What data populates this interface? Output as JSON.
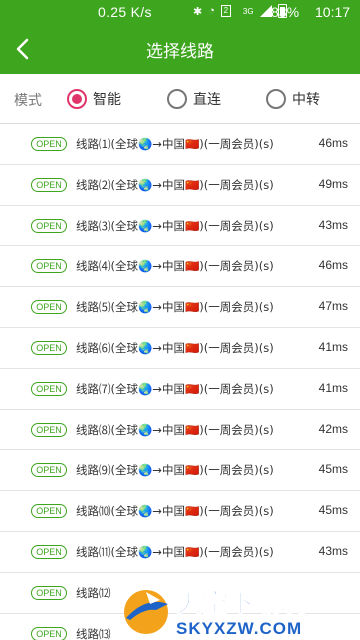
{
  "statusbar": {
    "speed": "0.25 K/s",
    "network_badge": "2",
    "network_type": "3G",
    "battery": "83%",
    "time": "10:17"
  },
  "header": {
    "title": "选择线路",
    "back_icon": "chevron-left-icon"
  },
  "mode": {
    "label": "模式",
    "options": [
      {
        "label": "智能",
        "selected": true
      },
      {
        "label": "直连",
        "selected": false
      },
      {
        "label": "中转",
        "selected": false
      }
    ],
    "accent_color": "#e0356b"
  },
  "theme": {
    "brand_color": "#3ea51f"
  },
  "routes": [
    {
      "badge": "OPEN",
      "name": "线路⑴(全球🌏→中国🇨🇳)(一周会员)(s)",
      "latency": "46ms"
    },
    {
      "badge": "OPEN",
      "name": "线路⑵(全球🌏→中国🇨🇳)(一周会员)(s)",
      "latency": "49ms"
    },
    {
      "badge": "OPEN",
      "name": "线路⑶(全球🌏→中国🇨🇳)(一周会员)(s)",
      "latency": "43ms"
    },
    {
      "badge": "OPEN",
      "name": "线路⑷(全球🌏→中国🇨🇳)(一周会员)(s)",
      "latency": "46ms"
    },
    {
      "badge": "OPEN",
      "name": "线路⑸(全球🌏→中国🇨🇳)(一周会员)(s)",
      "latency": "47ms"
    },
    {
      "badge": "OPEN",
      "name": "线路⑹(全球🌏→中国🇨🇳)(一周会员)(s)",
      "latency": "41ms"
    },
    {
      "badge": "OPEN",
      "name": "线路⑺(全球🌏→中国🇨🇳)(一周会员)(s)",
      "latency": "41ms"
    },
    {
      "badge": "OPEN",
      "name": "线路⑻(全球🌏→中国🇨🇳)(一周会员)(s)",
      "latency": "42ms"
    },
    {
      "badge": "OPEN",
      "name": "线路⑼(全球🌏→中国🇨🇳)(一周会员)(s)",
      "latency": "45ms"
    },
    {
      "badge": "OPEN",
      "name": "线路⑽(全球🌏→中国🇨🇳)(一周会员)(s)",
      "latency": "45ms"
    },
    {
      "badge": "OPEN",
      "name": "线路⑾(全球🌏→中国🇨🇳)(一周会员)(s)",
      "latency": "43ms"
    },
    {
      "badge": "OPEN",
      "name": "线路⑿",
      "latency": ""
    },
    {
      "badge": "OPEN",
      "name": "线路⒀",
      "latency": ""
    }
  ],
  "watermark": {
    "line1": "天空下载玩",
    "line2": "SKYXZW.COM"
  }
}
